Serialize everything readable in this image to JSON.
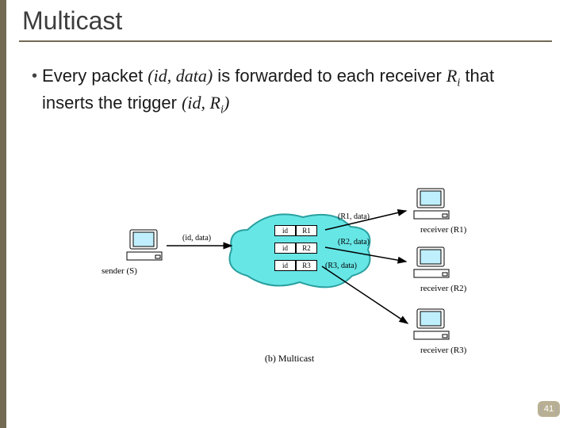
{
  "title": "Multicast",
  "bullet": {
    "pre": "Every packet ",
    "id_data": "(id, data)",
    "mid1": " is forwarded to each receiver ",
    "ri": "R",
    "sub_i": "i",
    "mid2": " that inserts the trigger ",
    "id_ri": "(id, R",
    "sub_i2": "i",
    "close": ")"
  },
  "diagram": {
    "sender_label": "sender (S)",
    "recv1": "receiver (R1)",
    "recv2": "receiver (R2)",
    "recv3": "receiver (R3)",
    "edge_in": "(id, data)",
    "edge_out1": "(R1, data)",
    "edge_out2": "(R2, data)",
    "edge_out3": "(R3, data)",
    "trig1_l": "id",
    "trig1_r": "R1",
    "trig2_l": "id",
    "trig2_r": "R2",
    "trig3_l": "id",
    "trig3_r": "R3",
    "caption": "(b) Multicast"
  },
  "page": "41"
}
